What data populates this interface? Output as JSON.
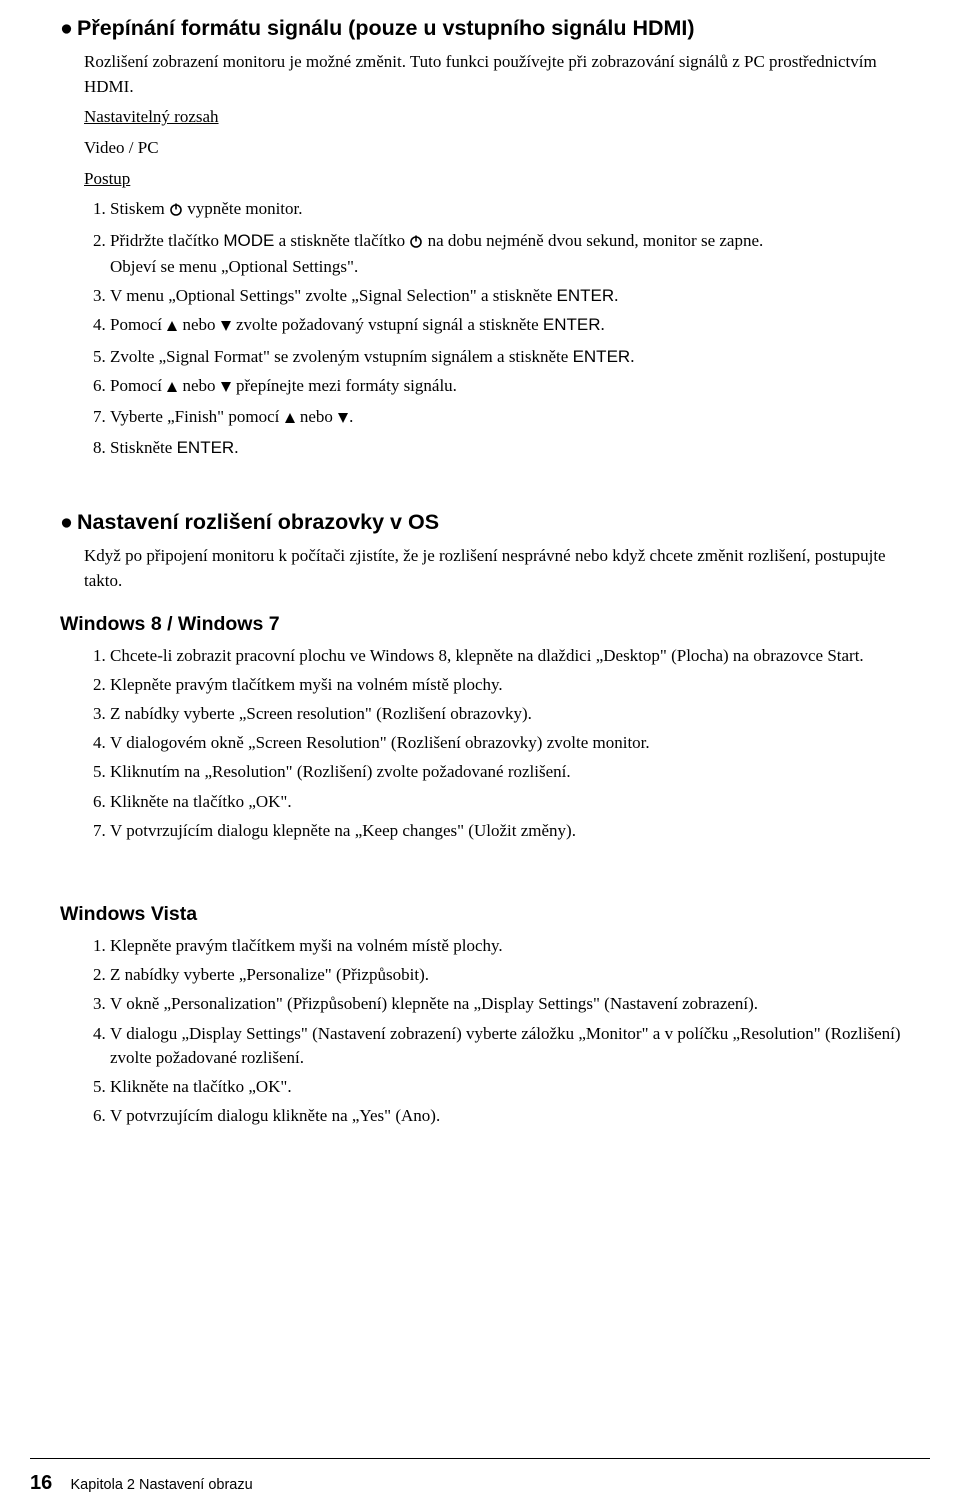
{
  "section1": {
    "heading": "Přepínání formátu signálu (pouze u vstupního signálu HDMI)",
    "intro": "Rozlišení zobrazení monitoru je možné změnit. Tuto funkci používejte při zobrazování signálů z PC prostřednictvím HDMI.",
    "range_label": "Nastavitelný rozsah",
    "range_value": "Video / PC",
    "procedure_label": "Postup",
    "steps": {
      "s1a": "Stiskem ",
      "s1b": " vypněte monitor.",
      "s2a": "Přidržte tlačítko ",
      "s2b": " a stiskněte tlačítko ",
      "s2c": " na dobu nejméně dvou sekund, monitor se zapne.",
      "s2_note": "Objeví se menu „Optional Settings\".",
      "s3a": "V menu „Optional Settings\" zvolte „Signal Selection\" a stiskněte ",
      "s4a": "Pomocí ",
      "s4b": " nebo ",
      "s4c": " zvolte požadovaný vstupní signál a stiskněte ",
      "s5a": "Zvolte „Signal Format\" se zvoleným vstupním signálem a stiskněte ",
      "s6a": "Pomocí ",
      "s6b": " nebo ",
      "s6c": " přepínejte mezi formáty signálu.",
      "s7a": "Vyberte „Finish\" pomocí ",
      "s7b": " nebo ",
      "s8a": "Stiskněte "
    },
    "mode": "MODE",
    "enter": "ENTER"
  },
  "section2": {
    "heading": "Nastavení rozlišení obrazovky v OS",
    "intro": "Když po připojení monitoru k počítači zjistíte, že je rozlišení nesprávné nebo když chcete změnit rozlišení, postupujte takto."
  },
  "win8": {
    "heading": "Windows 8 / Windows 7",
    "steps": {
      "s1": "Chcete-li zobrazit pracovní plochu ve Windows 8, klepněte na dlaždici „Desktop\" (Plocha) na obrazovce Start.",
      "s2": "Klepněte pravým tlačítkem myši na volném místě plochy.",
      "s3": "Z nabídky vyberte „Screen resolution\" (Rozlišení obrazovky).",
      "s4": "V dialogovém okně „Screen Resolution\" (Rozlišení obrazovky) zvolte monitor.",
      "s5": "Kliknutím na „Resolution\" (Rozlišení) zvolte požadované rozlišení.",
      "s6": "Klikněte na tlačítko „OK\".",
      "s7": "V potvrzujícím dialogu klepněte na „Keep changes\" (Uložit změny)."
    }
  },
  "vista": {
    "heading": "Windows Vista",
    "steps": {
      "s1": "Klepněte pravým tlačítkem myši na volném místě plochy.",
      "s2": "Z nabídky vyberte „Personalize\" (Přizpůsobit).",
      "s3": "V okně „Personalization\" (Přizpůsobení) klepněte na „Display Settings\" (Nastavení zobrazení).",
      "s4": "V dialogu „Display Settings\" (Nastavení zobrazení) vyberte záložku „Monitor\" a v políčku „Resolution\" (Rozlišení) zvolte požadované rozlišení.",
      "s5": "Klikněte na tlačítko „OK\".",
      "s6": "V potvrzujícím dialogu klikněte na „Yes\" (Ano)."
    }
  },
  "footer": {
    "page": "16",
    "chapter": "Kapitola 2 Nastavení obrazu"
  },
  "period": "."
}
